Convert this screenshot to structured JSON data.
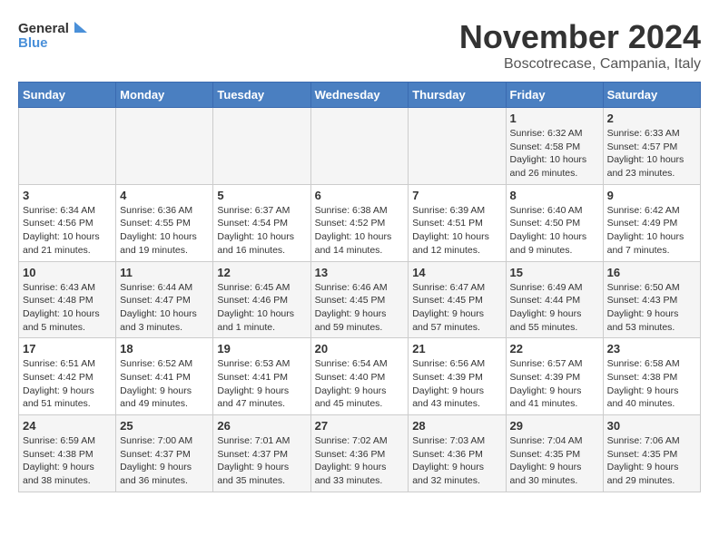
{
  "header": {
    "logo_line1": "General",
    "logo_line2": "Blue",
    "month": "November 2024",
    "location": "Boscotrecase, Campania, Italy"
  },
  "weekdays": [
    "Sunday",
    "Monday",
    "Tuesday",
    "Wednesday",
    "Thursday",
    "Friday",
    "Saturday"
  ],
  "weeks": [
    [
      {
        "day": "",
        "info": ""
      },
      {
        "day": "",
        "info": ""
      },
      {
        "day": "",
        "info": ""
      },
      {
        "day": "",
        "info": ""
      },
      {
        "day": "",
        "info": ""
      },
      {
        "day": "1",
        "info": "Sunrise: 6:32 AM\nSunset: 4:58 PM\nDaylight: 10 hours and 26 minutes."
      },
      {
        "day": "2",
        "info": "Sunrise: 6:33 AM\nSunset: 4:57 PM\nDaylight: 10 hours and 23 minutes."
      }
    ],
    [
      {
        "day": "3",
        "info": "Sunrise: 6:34 AM\nSunset: 4:56 PM\nDaylight: 10 hours and 21 minutes."
      },
      {
        "day": "4",
        "info": "Sunrise: 6:36 AM\nSunset: 4:55 PM\nDaylight: 10 hours and 19 minutes."
      },
      {
        "day": "5",
        "info": "Sunrise: 6:37 AM\nSunset: 4:54 PM\nDaylight: 10 hours and 16 minutes."
      },
      {
        "day": "6",
        "info": "Sunrise: 6:38 AM\nSunset: 4:52 PM\nDaylight: 10 hours and 14 minutes."
      },
      {
        "day": "7",
        "info": "Sunrise: 6:39 AM\nSunset: 4:51 PM\nDaylight: 10 hours and 12 minutes."
      },
      {
        "day": "8",
        "info": "Sunrise: 6:40 AM\nSunset: 4:50 PM\nDaylight: 10 hours and 9 minutes."
      },
      {
        "day": "9",
        "info": "Sunrise: 6:42 AM\nSunset: 4:49 PM\nDaylight: 10 hours and 7 minutes."
      }
    ],
    [
      {
        "day": "10",
        "info": "Sunrise: 6:43 AM\nSunset: 4:48 PM\nDaylight: 10 hours and 5 minutes."
      },
      {
        "day": "11",
        "info": "Sunrise: 6:44 AM\nSunset: 4:47 PM\nDaylight: 10 hours and 3 minutes."
      },
      {
        "day": "12",
        "info": "Sunrise: 6:45 AM\nSunset: 4:46 PM\nDaylight: 10 hours and 1 minute."
      },
      {
        "day": "13",
        "info": "Sunrise: 6:46 AM\nSunset: 4:45 PM\nDaylight: 9 hours and 59 minutes."
      },
      {
        "day": "14",
        "info": "Sunrise: 6:47 AM\nSunset: 4:45 PM\nDaylight: 9 hours and 57 minutes."
      },
      {
        "day": "15",
        "info": "Sunrise: 6:49 AM\nSunset: 4:44 PM\nDaylight: 9 hours and 55 minutes."
      },
      {
        "day": "16",
        "info": "Sunrise: 6:50 AM\nSunset: 4:43 PM\nDaylight: 9 hours and 53 minutes."
      }
    ],
    [
      {
        "day": "17",
        "info": "Sunrise: 6:51 AM\nSunset: 4:42 PM\nDaylight: 9 hours and 51 minutes."
      },
      {
        "day": "18",
        "info": "Sunrise: 6:52 AM\nSunset: 4:41 PM\nDaylight: 9 hours and 49 minutes."
      },
      {
        "day": "19",
        "info": "Sunrise: 6:53 AM\nSunset: 4:41 PM\nDaylight: 9 hours and 47 minutes."
      },
      {
        "day": "20",
        "info": "Sunrise: 6:54 AM\nSunset: 4:40 PM\nDaylight: 9 hours and 45 minutes."
      },
      {
        "day": "21",
        "info": "Sunrise: 6:56 AM\nSunset: 4:39 PM\nDaylight: 9 hours and 43 minutes."
      },
      {
        "day": "22",
        "info": "Sunrise: 6:57 AM\nSunset: 4:39 PM\nDaylight: 9 hours and 41 minutes."
      },
      {
        "day": "23",
        "info": "Sunrise: 6:58 AM\nSunset: 4:38 PM\nDaylight: 9 hours and 40 minutes."
      }
    ],
    [
      {
        "day": "24",
        "info": "Sunrise: 6:59 AM\nSunset: 4:38 PM\nDaylight: 9 hours and 38 minutes."
      },
      {
        "day": "25",
        "info": "Sunrise: 7:00 AM\nSunset: 4:37 PM\nDaylight: 9 hours and 36 minutes."
      },
      {
        "day": "26",
        "info": "Sunrise: 7:01 AM\nSunset: 4:37 PM\nDaylight: 9 hours and 35 minutes."
      },
      {
        "day": "27",
        "info": "Sunrise: 7:02 AM\nSunset: 4:36 PM\nDaylight: 9 hours and 33 minutes."
      },
      {
        "day": "28",
        "info": "Sunrise: 7:03 AM\nSunset: 4:36 PM\nDaylight: 9 hours and 32 minutes."
      },
      {
        "day": "29",
        "info": "Sunrise: 7:04 AM\nSunset: 4:35 PM\nDaylight: 9 hours and 30 minutes."
      },
      {
        "day": "30",
        "info": "Sunrise: 7:06 AM\nSunset: 4:35 PM\nDaylight: 9 hours and 29 minutes."
      }
    ]
  ]
}
